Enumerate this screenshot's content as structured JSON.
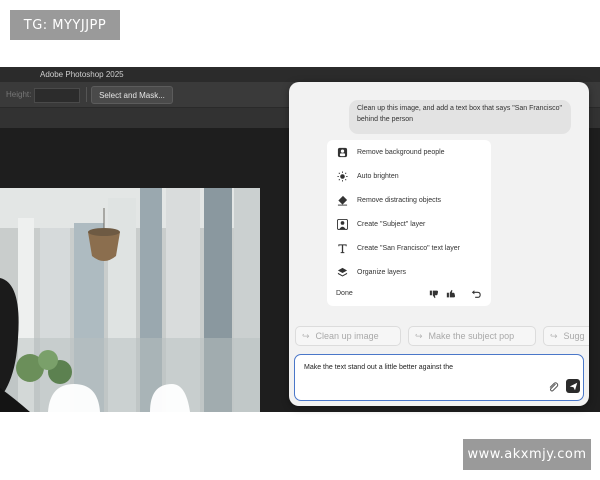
{
  "watermarks": {
    "top": "TG: MYYJJPP",
    "bottom": "www.akxmjy.com"
  },
  "photoshop": {
    "app_title": "Adobe Photoshop 2025",
    "options_bar": {
      "height_label": "Height:",
      "height_value": "",
      "select_and_mask": "Select and Mask..."
    }
  },
  "assistant": {
    "user_message": "Clean up this image, and add a text box that says \"San Francisco\" behind the person",
    "steps": [
      {
        "label": "Remove background people",
        "icon": "people-remove-icon"
      },
      {
        "label": "Auto brighten",
        "icon": "sun-icon"
      },
      {
        "label": "Remove distracting objects",
        "icon": "eraser-icon"
      },
      {
        "label": "Create \"Subject\" layer",
        "icon": "person-icon"
      },
      {
        "label": "Create \"San Francisco\" text layer",
        "icon": "text-icon"
      },
      {
        "label": "Organize layers",
        "icon": "layers-icon"
      }
    ],
    "done_label": "Done",
    "suggestions": [
      "Clean up image",
      "Make the subject pop",
      "Sugg"
    ],
    "prompt_value": "Make the text stand out a little better against the"
  },
  "colors": {
    "accent": "#4a77c9",
    "panel_bg": "#f2f2f2",
    "app_bg": "#1e1e1e"
  }
}
